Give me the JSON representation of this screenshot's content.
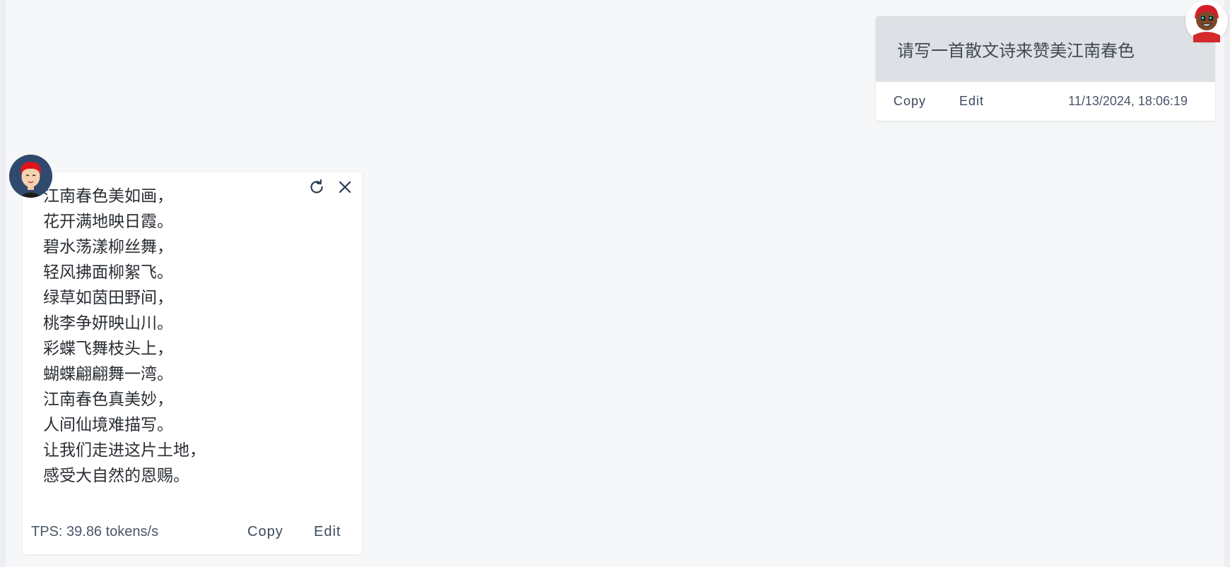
{
  "user_message": {
    "text": "请写一首散文诗来赞美江南春色",
    "copy_label": "Copy",
    "edit_label": "Edit",
    "timestamp": "11/13/2024, 18:06:19"
  },
  "assistant_message": {
    "lines": [
      "江南春色美如画，",
      "花开满地映日霞。",
      "碧水荡漾柳丝舞，",
      "轻风拂面柳絮飞。",
      "绿草如茵田野间，",
      "桃李争妍映山川。",
      "彩蝶飞舞枝头上，",
      "蝴蝶翩翩舞一湾。",
      "江南春色真美妙，",
      "人间仙境难描写。",
      "让我们走进这片土地，",
      "感受大自然的恩赐。"
    ],
    "tps": "TPS: 39.86 tokens/s",
    "copy_label": "Copy",
    "edit_label": "Edit",
    "icons": {
      "regenerate": "refresh-icon",
      "close": "close-icon"
    }
  },
  "avatars": {
    "user": "user-avatar",
    "assistant": "assistant-avatar"
  },
  "colors": {
    "background": "#f6f7f8",
    "user_bubble": "#dde1e5",
    "text_muted": "#3b4a5e"
  }
}
